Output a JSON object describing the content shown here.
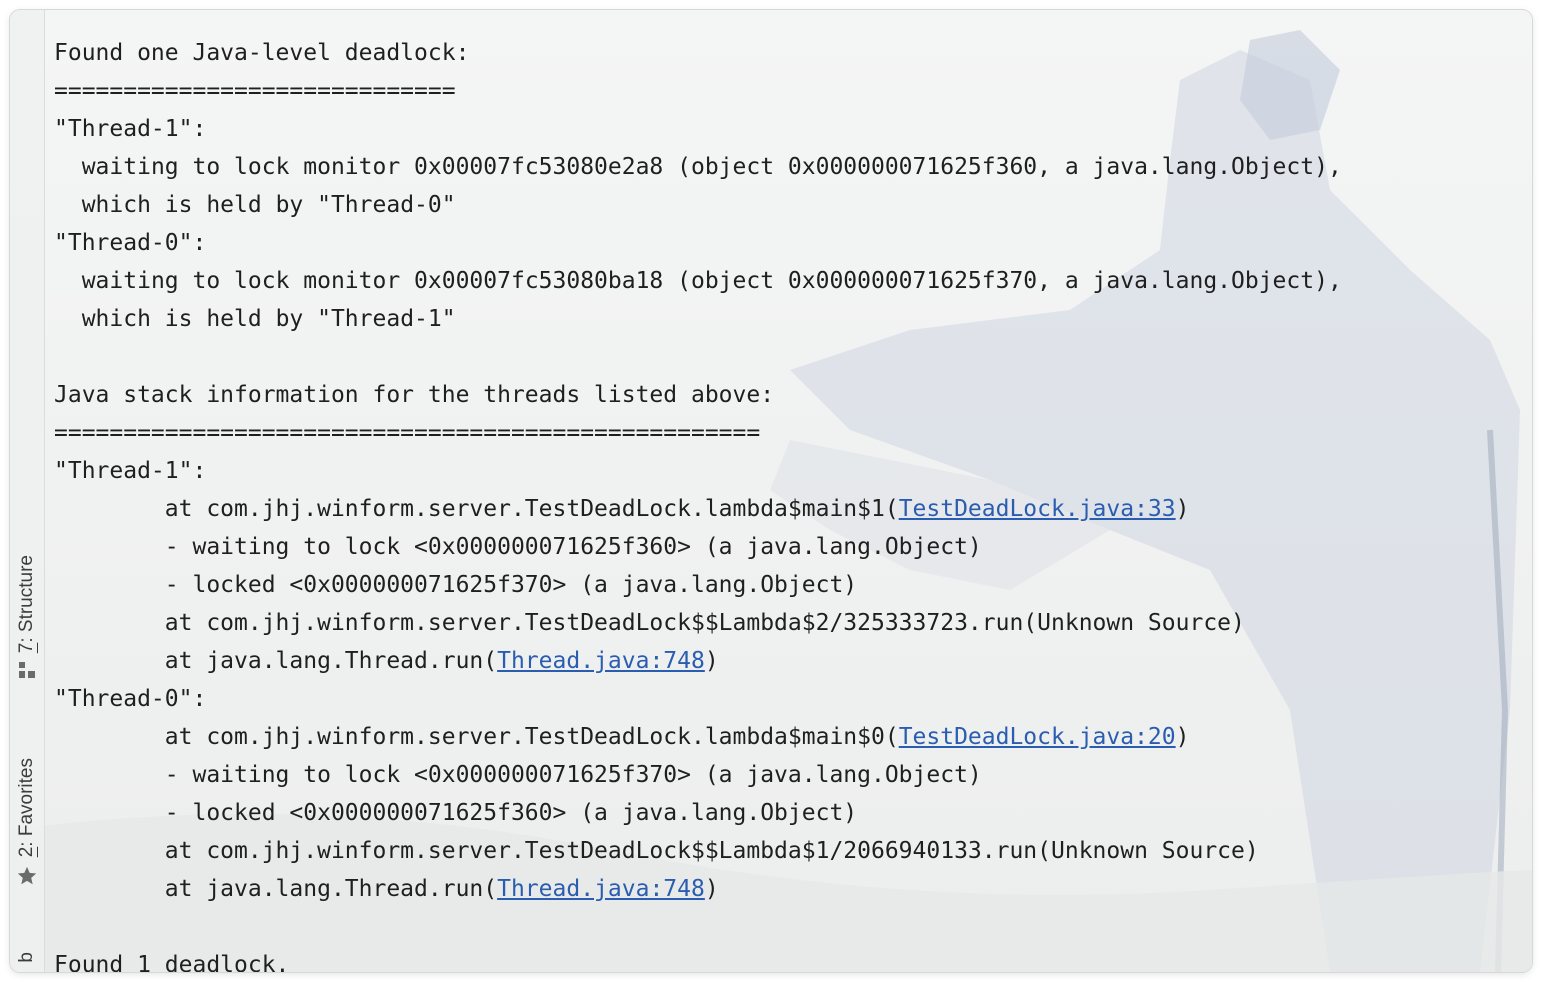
{
  "sidebar": {
    "structure_tab": {
      "num": "7",
      "label": ": Structure",
      "icon": "structure-icon"
    },
    "favorites_tab": {
      "num": "2",
      "label": ": Favorites",
      "icon": "star-icon"
    },
    "bottom_tab_partial": "b"
  },
  "console": {
    "lines": [
      {
        "indent": "",
        "text": "Found one Java-level deadlock:"
      },
      {
        "indent": "",
        "text": "============================="
      },
      {
        "indent": "",
        "text": "\"Thread-1\":"
      },
      {
        "indent": "  ",
        "text": "waiting to lock monitor 0x00007fc53080e2a8 (object 0x000000071625f360, a java.lang.Object),"
      },
      {
        "indent": "  ",
        "text": "which is held by \"Thread-0\""
      },
      {
        "indent": "",
        "text": "\"Thread-0\":"
      },
      {
        "indent": "  ",
        "text": "waiting to lock monitor 0x00007fc53080ba18 (object 0x000000071625f370, a java.lang.Object),"
      },
      {
        "indent": "  ",
        "text": "which is held by \"Thread-1\""
      },
      {
        "indent": "",
        "text": ""
      },
      {
        "indent": "",
        "text": "Java stack information for the threads listed above:"
      },
      {
        "indent": "",
        "text": "==================================================="
      },
      {
        "indent": "",
        "text": "\"Thread-1\":"
      },
      {
        "indent": "        ",
        "text": "at com.jhj.winform.server.TestDeadLock.lambda$main$1(",
        "link": "TestDeadLock.java:33",
        "after": ")"
      },
      {
        "indent": "        ",
        "text": "- waiting to lock <0x000000071625f360> (a java.lang.Object)"
      },
      {
        "indent": "        ",
        "text": "- locked <0x000000071625f370> (a java.lang.Object)"
      },
      {
        "indent": "        ",
        "text": "at com.jhj.winform.server.TestDeadLock$$Lambda$2/325333723.run(Unknown Source)"
      },
      {
        "indent": "        ",
        "text": "at java.lang.Thread.run(",
        "link": "Thread.java:748",
        "after": ")"
      },
      {
        "indent": "",
        "text": "\"Thread-0\":"
      },
      {
        "indent": "        ",
        "text": "at com.jhj.winform.server.TestDeadLock.lambda$main$0(",
        "link": "TestDeadLock.java:20",
        "after": ")"
      },
      {
        "indent": "        ",
        "text": "- waiting to lock <0x000000071625f370> (a java.lang.Object)"
      },
      {
        "indent": "        ",
        "text": "- locked <0x000000071625f360> (a java.lang.Object)"
      },
      {
        "indent": "        ",
        "text": "at com.jhj.winform.server.TestDeadLock$$Lambda$1/2066940133.run(Unknown Source)"
      },
      {
        "indent": "        ",
        "text": "at java.lang.Thread.run(",
        "link": "Thread.java:748",
        "after": ")"
      },
      {
        "indent": "",
        "text": ""
      },
      {
        "indent": "",
        "text": "Found 1 deadlock."
      }
    ]
  },
  "colors": {
    "text": "#1f1f1f",
    "link": "#2a5db0",
    "background": "#f3f4f4"
  }
}
